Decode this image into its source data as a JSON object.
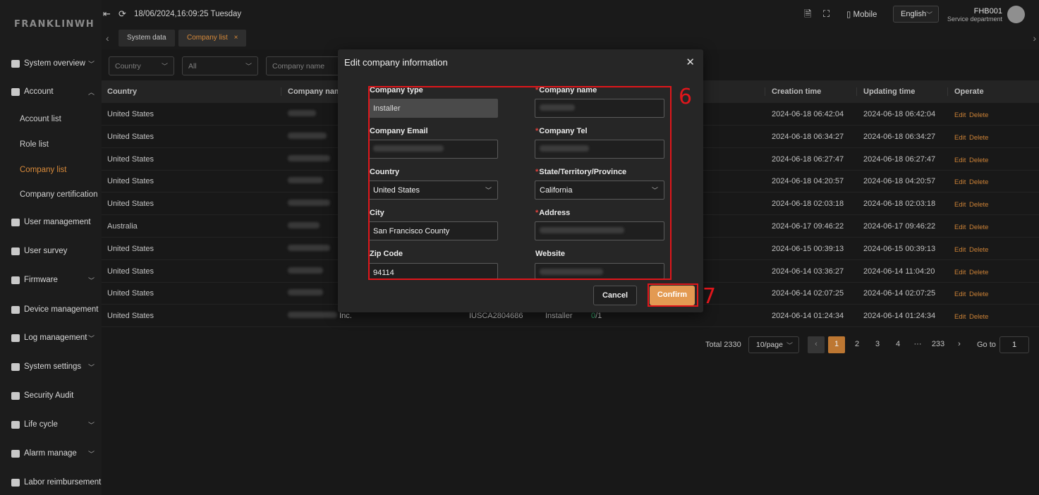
{
  "brand": {
    "logo_text": "FRANKLINWH"
  },
  "topbar": {
    "datetime": "18/06/2024,16:09:25 Tuesday",
    "mobile_label": "Mobile",
    "language": "English",
    "user_name": "FHB001",
    "user_dept": "Service department"
  },
  "sidebar": {
    "items": [
      {
        "label": "System overview",
        "icon": "monitor-icon",
        "expandable": true
      },
      {
        "label": "Account",
        "icon": "account-icon",
        "expandable": true
      },
      {
        "label": "User management",
        "icon": "users-icon",
        "expandable": false
      },
      {
        "label": "User survey",
        "icon": "chart-icon",
        "expandable": false
      },
      {
        "label": "Firmware",
        "icon": "chip-icon",
        "expandable": true
      },
      {
        "label": "Device management",
        "icon": "device-icon",
        "expandable": false
      },
      {
        "label": "Log management",
        "icon": "log-icon",
        "expandable": true
      },
      {
        "label": "System settings",
        "icon": "gear-icon",
        "expandable": true
      },
      {
        "label": "Security Audit",
        "icon": "shield-icon",
        "expandable": false
      },
      {
        "label": "Life cycle",
        "icon": "cycle-icon",
        "expandable": true
      },
      {
        "label": "Alarm manage",
        "icon": "alarm-icon",
        "expandable": true
      },
      {
        "label": "Labor reimbursement",
        "icon": "receipt-icon",
        "expandable": false
      }
    ],
    "account_sub": [
      "Account list",
      "Role list",
      "Company list",
      "Company certification"
    ]
  },
  "tabs": [
    {
      "label": "System data"
    },
    {
      "label": "Company list",
      "close": "×"
    }
  ],
  "filters": {
    "country_placeholder": "Country",
    "type_value": "All",
    "company_placeholder": "Company name"
  },
  "table": {
    "headers": {
      "country": "Country",
      "company": "Company nam",
      "creation": "Creation time",
      "updating": "Updating time",
      "operate": "Operate"
    },
    "edit_label": "Edit",
    "delete_label": "Delete",
    "rows": [
      {
        "country": "United States",
        "created": "2024-06-18 06:42:04",
        "updated": "2024-06-18 06:42:04"
      },
      {
        "country": "United States",
        "created": "2024-06-18 06:34:27",
        "updated": "2024-06-18 06:34:27"
      },
      {
        "country": "United States",
        "created": "2024-06-18 06:27:47",
        "updated": "2024-06-18 06:27:47"
      },
      {
        "country": "United States",
        "created": "2024-06-18 04:20:57",
        "updated": "2024-06-18 04:20:57"
      },
      {
        "country": "United States",
        "created": "2024-06-18 02:03:18",
        "updated": "2024-06-18 02:03:18"
      },
      {
        "country": "Australia",
        "created": "2024-06-17 09:46:22",
        "updated": "2024-06-17 09:46:22"
      },
      {
        "country": "United States",
        "created": "2024-06-15 00:39:13",
        "updated": "2024-06-15 00:39:13"
      },
      {
        "country": "United States",
        "created": "2024-06-14 03:36:27",
        "updated": "2024-06-14 11:04:20"
      },
      {
        "country": "United States",
        "created": "2024-06-14 02:07:25",
        "updated": "2024-06-14 02:07:25"
      },
      {
        "country": "United States",
        "created": "2024-06-14 01:24:34",
        "updated": "2024-06-14 01:24:34",
        "company_suffix": "Inc.",
        "code": "IUSCA2804686",
        "type": "Installer",
        "ratio_num": "0",
        "ratio_den": "/1"
      }
    ]
  },
  "pagination": {
    "total": "Total 2330",
    "page_size": "10/page",
    "pages": [
      "1",
      "2",
      "3",
      "4",
      "···",
      "233"
    ],
    "prev": "‹",
    "next": "›",
    "goto_label": "Go to",
    "goto_value": "1"
  },
  "modal": {
    "title": "Edit company information",
    "close": "✕",
    "fields": {
      "company_type": {
        "label": "Company type",
        "value": "Installer"
      },
      "company_name": {
        "label": "Company name"
      },
      "company_email": {
        "label": "Company Email"
      },
      "company_tel": {
        "label": "Company Tel"
      },
      "country": {
        "label": "Country",
        "value": "United States"
      },
      "state": {
        "label": "State/Territory/Province",
        "value": "California"
      },
      "city": {
        "label": "City",
        "value": "San Francisco County"
      },
      "address": {
        "label": "Address"
      },
      "zip": {
        "label": "Zip Code",
        "value": "94114"
      },
      "website": {
        "label": "Website"
      }
    },
    "cancel_label": "Cancel",
    "confirm_label": "Confirm"
  },
  "annotations": {
    "form_marker": "6",
    "confirm_marker": "7"
  },
  "colors": {
    "accent": "#d88a3a",
    "annotation": "#e0161b",
    "confirm_button": "#e39a52"
  }
}
